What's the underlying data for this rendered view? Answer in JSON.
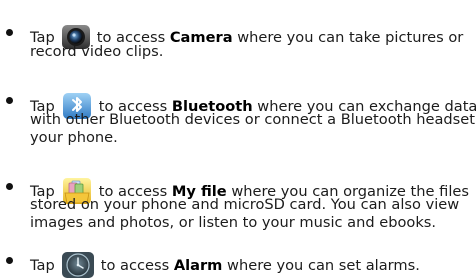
{
  "items": [
    {
      "icon": "camera-icon",
      "tap": "Tap",
      "pre": "to access",
      "keyword": "Camera",
      "rest": "where you can take pictures or",
      "lines": [
        "record video clips."
      ]
    },
    {
      "icon": "bluetooth-icon",
      "tap": "Tap",
      "pre": "to access",
      "keyword": "Bluetooth",
      "rest": "where you can exchange data",
      "lines": [
        "with other Bluetooth devices or connect a Bluetooth headset to",
        "your phone."
      ]
    },
    {
      "icon": "folder-icon",
      "tap": "Tap",
      "pre": "to access",
      "keyword": "My file",
      "rest": "where you can organize the files",
      "lines": [
        "stored on your phone and microSD card. You can also view",
        "images and photos, or listen to your music and ebooks."
      ]
    },
    {
      "icon": "alarm-clock-icon",
      "tap": "Tap",
      "pre": "to access",
      "keyword": "Alarm",
      "rest": "where you can set alarms.",
      "lines": []
    }
  ]
}
